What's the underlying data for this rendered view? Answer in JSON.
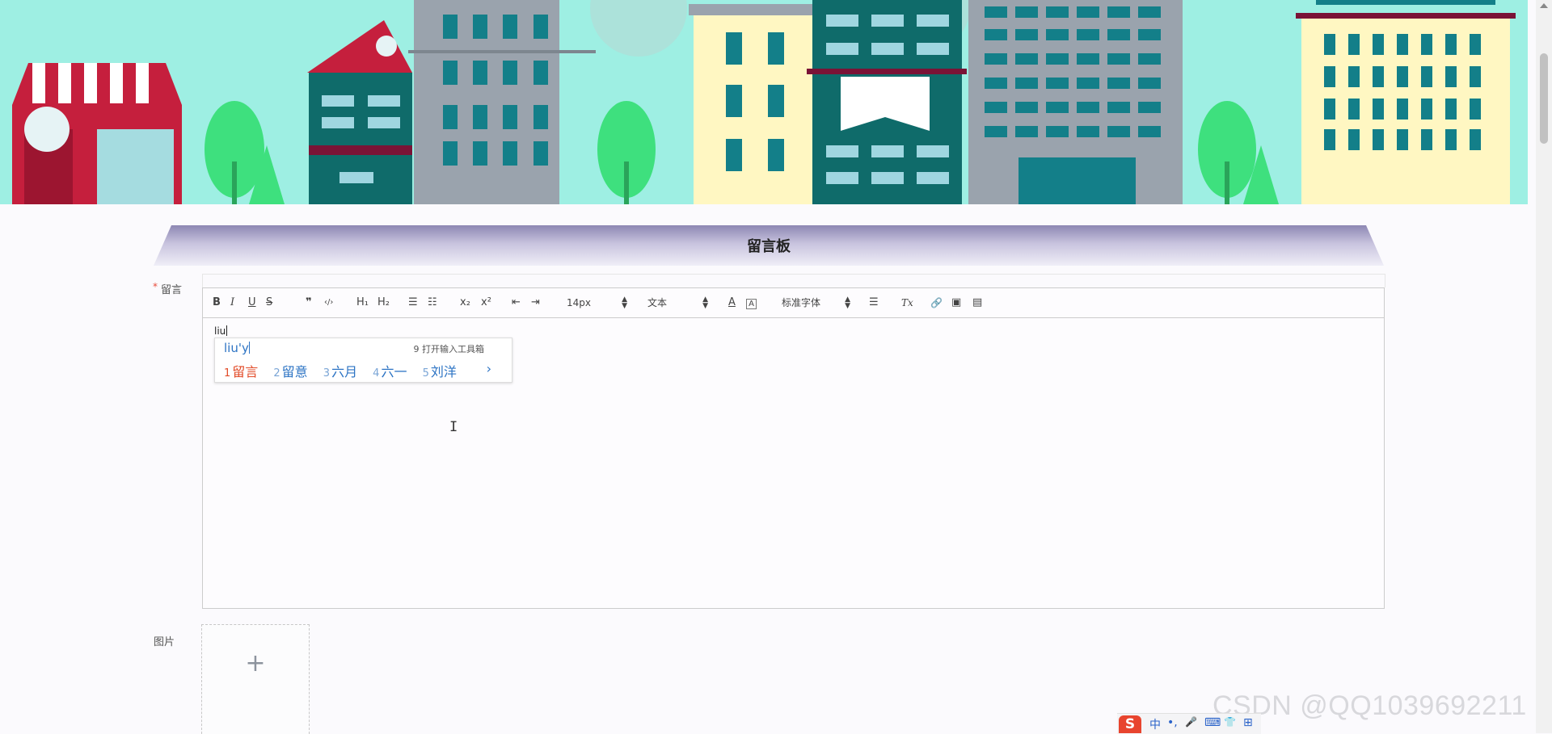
{
  "board": {
    "title": "留言板"
  },
  "form": {
    "message_label": "留言",
    "image_label": "图片",
    "required_mark": "*"
  },
  "toolbar": {
    "bold": "B",
    "italic": "I",
    "underline": "U",
    "strike": "S",
    "quote": "❞",
    "code": "‹/›",
    "h1": "H₁",
    "h2": "H₂",
    "ordered": "☰",
    "bullet": "☷",
    "sub": "x₂",
    "sup": "x²",
    "outdent": "⇤",
    "indent": "⇥",
    "size_value": "14px",
    "header_value": "文本",
    "font_value": "标准字体",
    "color": "A",
    "bg": "A",
    "align": "☰",
    "clean": "Tx",
    "link": "🔗",
    "image": "▣",
    "video": "▤"
  },
  "editor": {
    "typed_text": "liu"
  },
  "ime": {
    "composition": "liu'y",
    "toolbox": "9 打开输入工具箱",
    "candidates": [
      {
        "num": "1",
        "text": "留言"
      },
      {
        "num": "2",
        "text": "留意"
      },
      {
        "num": "3",
        "text": "六月"
      },
      {
        "num": "4",
        "text": "六一"
      },
      {
        "num": "5",
        "text": "刘洋"
      }
    ],
    "next": "›"
  },
  "upload": {
    "plus": "+"
  },
  "watermark": "CSDN @QQ1039692211",
  "tray": {
    "logo": "S",
    "items": [
      "中",
      "•,",
      "🎤",
      "⌨",
      "👕",
      "⊞"
    ]
  },
  "colors": {
    "sky": "#9eefe3",
    "accent_header": "#8d87b3",
    "ime_blue": "#2d74c4",
    "ime_selected": "#e24b28",
    "required": "#e74c3c"
  }
}
